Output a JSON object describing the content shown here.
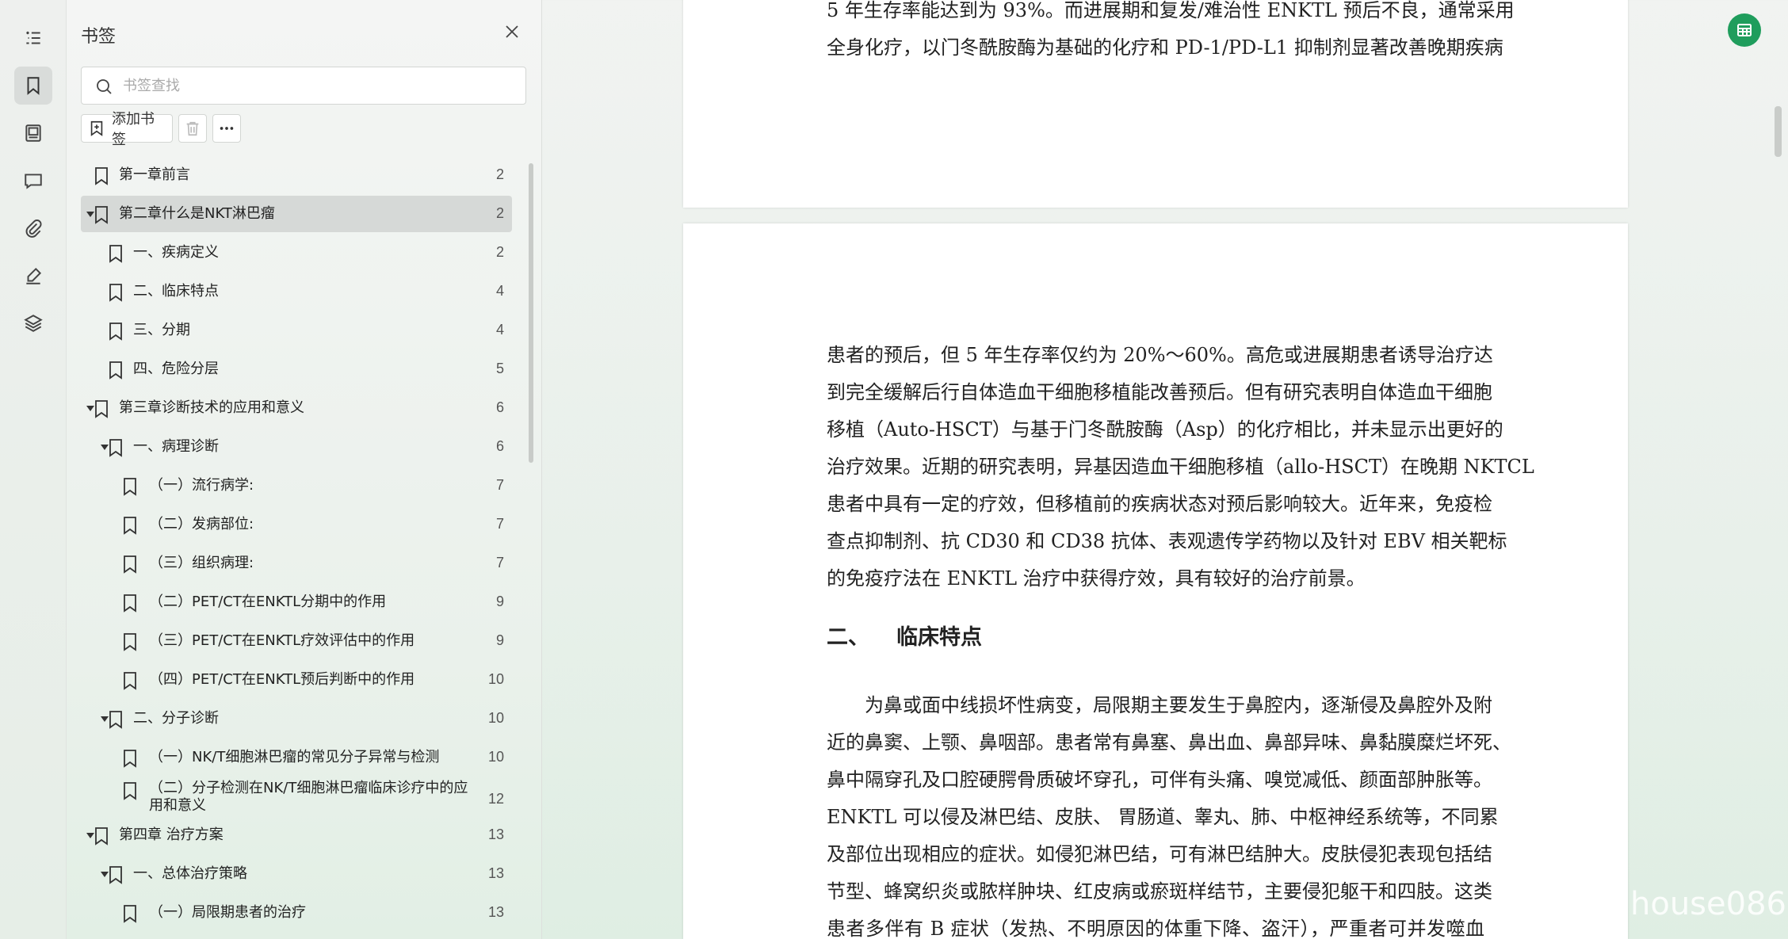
{
  "rail": {
    "items": [
      {
        "icon": "toc-list-icon"
      },
      {
        "icon": "bookmark-icon",
        "active": true
      },
      {
        "icon": "image-icon"
      },
      {
        "icon": "comment-icon"
      },
      {
        "icon": "attachment-icon"
      },
      {
        "icon": "signature-pen-icon"
      },
      {
        "icon": "layers-icon"
      }
    ]
  },
  "panel": {
    "title": "书签",
    "search_placeholder": "书签查找",
    "add_bookmark_label": "添加书签",
    "nodes": [
      {
        "label": "第一章前言",
        "page": "2",
        "level": 0,
        "arrow": false
      },
      {
        "label": "第二章什么是NKT淋巴瘤",
        "page": "2",
        "level": 0,
        "arrow": true,
        "selected": true
      },
      {
        "label": "一、疾病定义",
        "page": "2",
        "level": 1,
        "arrow": false
      },
      {
        "label": "二、临床特点",
        "page": "4",
        "level": 1,
        "arrow": false
      },
      {
        "label": "三、分期",
        "page": "4",
        "level": 1,
        "arrow": false
      },
      {
        "label": "四、危险分层",
        "page": "5",
        "level": 1,
        "arrow": false
      },
      {
        "label": "第三章诊断技术的应用和意义",
        "page": "6",
        "level": 0,
        "arrow": true
      },
      {
        "label": "一、病理诊断",
        "page": "6",
        "level": 1,
        "arrow": true
      },
      {
        "label": "（一）流行病学:",
        "page": "7",
        "level": 2,
        "arrow": false
      },
      {
        "label": "（二）发病部位:",
        "page": "7",
        "level": 2,
        "arrow": false
      },
      {
        "label": "（三）组织病理:",
        "page": "7",
        "level": 2,
        "arrow": false
      },
      {
        "label": "（二）PET/CT在ENKTL分期中的作用",
        "page": "9",
        "level": 2,
        "arrow": false
      },
      {
        "label": "（三）PET/CT在ENKTL疗效评估中的作用",
        "page": "9",
        "level": 2,
        "arrow": false
      },
      {
        "label": "（四）PET/CT在ENKTL预后判断中的作用",
        "page": "10",
        "level": 2,
        "arrow": false
      },
      {
        "label": "二、分子诊断",
        "page": "10",
        "level": 1,
        "arrow": true
      },
      {
        "label": "（一）NK/T细胞淋巴瘤的常见分子异常与检测",
        "page": "10",
        "level": 2,
        "arrow": false
      },
      {
        "label": "（二）分子检测在NK/T细胞淋巴瘤临床诊疗中的应用和意义",
        "page": "12",
        "level": 2,
        "arrow": false,
        "wrap": true
      },
      {
        "label": "第四章 治疗方案",
        "page": "13",
        "level": 0,
        "arrow": true
      },
      {
        "label": "一、总体治疗策略",
        "page": "13",
        "level": 1,
        "arrow": true
      },
      {
        "label": "（一）局限期患者的治疗",
        "page": "13",
        "level": 2,
        "arrow": false
      }
    ]
  },
  "document": {
    "page1_lines": [
      "5 年生存率能达到为 93%。而进展期和复发/难治性 ENKTL 预后不良，通常采用",
      "全身化疗，以门冬酰胺酶为基础的化疗和 PD-1/PD-L1 抑制剂显著改善晚期疾病"
    ],
    "para1_lines": [
      "患者的预后，但 5 年生存率仅约为  20%～60%。高危或进展期患者诱导治疗达",
      "到完全缓解后行自体造血干细胞移植能改善预后。但有研究表明自体造血干细胞",
      "移植（Auto-HSCT）与基于门冬酰胺酶（Asp）的化疗相比，并未显示出更好的",
      "治疗效果。近期的研究表明，异基因造血干细胞移植（allo-HSCT）在晚期 NKTCL",
      "患者中具有一定的疗效，但移植前的疾病状态对预后影响较大。近年来，免疫检",
      "查点抑制剂、抗 CD30 和 CD38 抗体、表观遗传学药物以及针对 EBV 相关靶标",
      "的免疫疗法在 ENKTL 治疗中获得疗效，具有较好的治疗前景。"
    ],
    "heading_num": "二、",
    "heading_text": "临床特点",
    "para2_lines": [
      "　　为鼻或面中线损坏性病变，局限期主要发生于鼻腔内，逐渐侵及鼻腔外及附",
      "近的鼻窦、上颚、鼻咽部。患者常有鼻塞、鼻出血、鼻部异味、鼻黏膜糜烂坏死、",
      "鼻中隔穿孔及口腔硬腭骨质破坏穿孔，可伴有头痛、嗅觉减低、颜面部肿胀等。",
      "ENKTL 可以侵及淋巴结、皮肤、 胃肠道、睾丸、肺、中枢神经系统等，不同累",
      "及部位出现相应的症状。如侵犯淋巴结，可有淋巴结肿大。皮肤侵犯表现包括结",
      "节型、蜂窝织炎或脓样肿块、红皮病或瘀斑样结节，主要侵犯躯干和四肢。这类",
      "患者多伴有 B 症状（发热、不明原因的体重下降、盗汗），严重者可并发噬血"
    ]
  },
  "watermark": "house086",
  "colors": {
    "accent": "#1f9d5c",
    "selected_row": "#d6d9d7"
  }
}
